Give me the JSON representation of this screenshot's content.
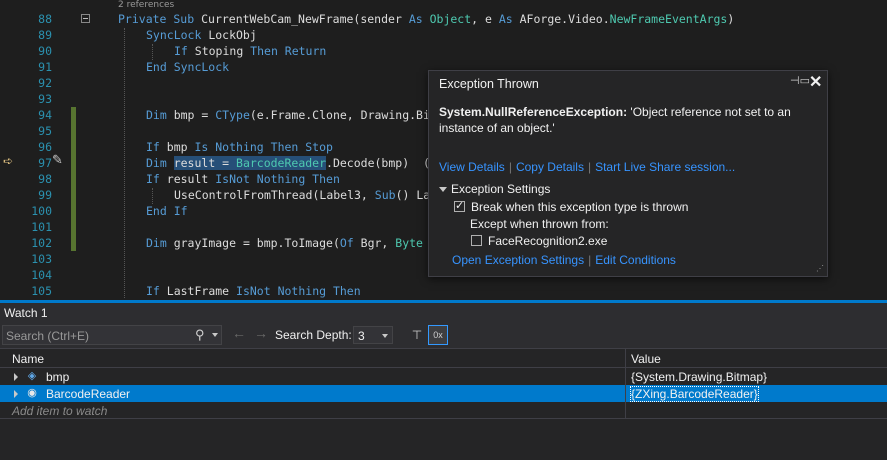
{
  "editor": {
    "references": "2 references",
    "lines": [
      {
        "num": "88",
        "indent": 118,
        "tokens": [
          [
            "k",
            "Private Sub "
          ],
          [
            "i",
            "CurrentWebCam_NewFrame(sender "
          ],
          [
            "k",
            "As "
          ],
          [
            "t",
            "Object"
          ],
          [
            "i",
            ", e "
          ],
          [
            "k",
            "As "
          ],
          [
            "i",
            "AForge.Video."
          ],
          [
            "t",
            "NewFrameEventArgs"
          ],
          [
            "i",
            ")"
          ]
        ]
      },
      {
        "num": "89",
        "indent": 146,
        "tokens": [
          [
            "k",
            "SyncLock "
          ],
          [
            "i",
            "LockObj"
          ]
        ]
      },
      {
        "num": "90",
        "indent": 174,
        "tokens": [
          [
            "k",
            "If "
          ],
          [
            "i",
            "Stoping "
          ],
          [
            "k",
            "Then Return"
          ]
        ]
      },
      {
        "num": "91",
        "indent": 146,
        "tokens": [
          [
            "k",
            "End SyncLock"
          ]
        ]
      },
      {
        "num": "92",
        "indent": 146,
        "tokens": []
      },
      {
        "num": "93",
        "indent": 146,
        "tokens": []
      },
      {
        "num": "94",
        "indent": 146,
        "tokens": [
          [
            "k",
            "Dim "
          ],
          [
            "i",
            "bmp = "
          ],
          [
            "k",
            "CType"
          ],
          [
            "i",
            "(e.Frame.Clone, Drawing.Bi"
          ]
        ]
      },
      {
        "num": "95",
        "indent": 146,
        "tokens": []
      },
      {
        "num": "96",
        "indent": 146,
        "tokens": [
          [
            "k",
            "If "
          ],
          [
            "i",
            "bmp "
          ],
          [
            "k",
            "Is Nothing Then Stop"
          ]
        ]
      },
      {
        "num": "97",
        "indent": 146,
        "tokens": [
          [
            "k",
            "Dim "
          ],
          [
            "h",
            "result = "
          ],
          [
            "ht",
            "BarcodeReader"
          ],
          [
            "i",
            ".Decode(bmp)  ("
          ]
        ]
      },
      {
        "num": "98",
        "indent": 146,
        "tokens": [
          [
            "k",
            "If "
          ],
          [
            "i",
            "result "
          ],
          [
            "k",
            "IsNot Nothing Then"
          ]
        ]
      },
      {
        "num": "99",
        "indent": 174,
        "tokens": [
          [
            "i",
            "UseControlFromThread(Label3, "
          ],
          [
            "k",
            "Sub"
          ],
          [
            "i",
            "() La"
          ]
        ]
      },
      {
        "num": "100",
        "indent": 146,
        "tokens": [
          [
            "k",
            "End If"
          ]
        ]
      },
      {
        "num": "101",
        "indent": 146,
        "tokens": []
      },
      {
        "num": "102",
        "indent": 146,
        "tokens": [
          [
            "k",
            "Dim "
          ],
          [
            "i",
            "grayImage = bmp.ToImage("
          ],
          [
            "k",
            "Of "
          ],
          [
            "i",
            "Bgr, "
          ],
          [
            "t",
            "Byte"
          ]
        ]
      },
      {
        "num": "103",
        "indent": 146,
        "tokens": []
      },
      {
        "num": "104",
        "indent": 146,
        "tokens": []
      },
      {
        "num": "105",
        "indent": 146,
        "tokens": [
          [
            "k",
            "If "
          ],
          [
            "i",
            "LastFrame "
          ],
          [
            "k",
            "IsNot Nothing Then"
          ]
        ]
      }
    ]
  },
  "exception": {
    "title": "Exception Thrown",
    "type": "System.NullReferenceException:",
    "message": " 'Object reference not set to an instance of an object.'",
    "links": [
      "View Details",
      "Copy Details",
      "Start Live Share session..."
    ],
    "settings_title": "Exception Settings",
    "break_label": "Break when this exception type is thrown",
    "break_checked": true,
    "except_label": "Except when thrown from:",
    "module_label": "FaceRecognition2.exe",
    "module_checked": false,
    "links2": [
      "Open Exception Settings",
      "Edit Conditions"
    ]
  },
  "watch": {
    "title": "Watch 1",
    "search_placeholder": "Search (Ctrl+E)",
    "search_depth_label": "Search Depth:",
    "search_depth_value": "3",
    "columns": {
      "name": "Name",
      "value": "Value"
    },
    "rows": [
      {
        "name": "bmp",
        "value": "{System.Drawing.Bitmap}",
        "selected": false
      },
      {
        "name": "BarcodeReader",
        "value": "{ZXing.BarcodeReader}",
        "selected": true
      }
    ],
    "add_placeholder": "Add item to watch"
  },
  "colors": {
    "keyword": "#569cd6",
    "identifier": "#dcdcdc",
    "type": "#4ec9b0",
    "line_number": "#2b91af",
    "link": "#3794ff",
    "accent": "#007acc",
    "change_bar": "#577430"
  },
  "icons": [
    "current-statement-arrow-icon",
    "edit-pencil-icon",
    "pin-icon",
    "close-icon",
    "search-icon",
    "back-arrow-icon",
    "forward-arrow-icon",
    "filter-icon",
    "hex-display-icon",
    "object-icon",
    "resize-grip-icon"
  ]
}
